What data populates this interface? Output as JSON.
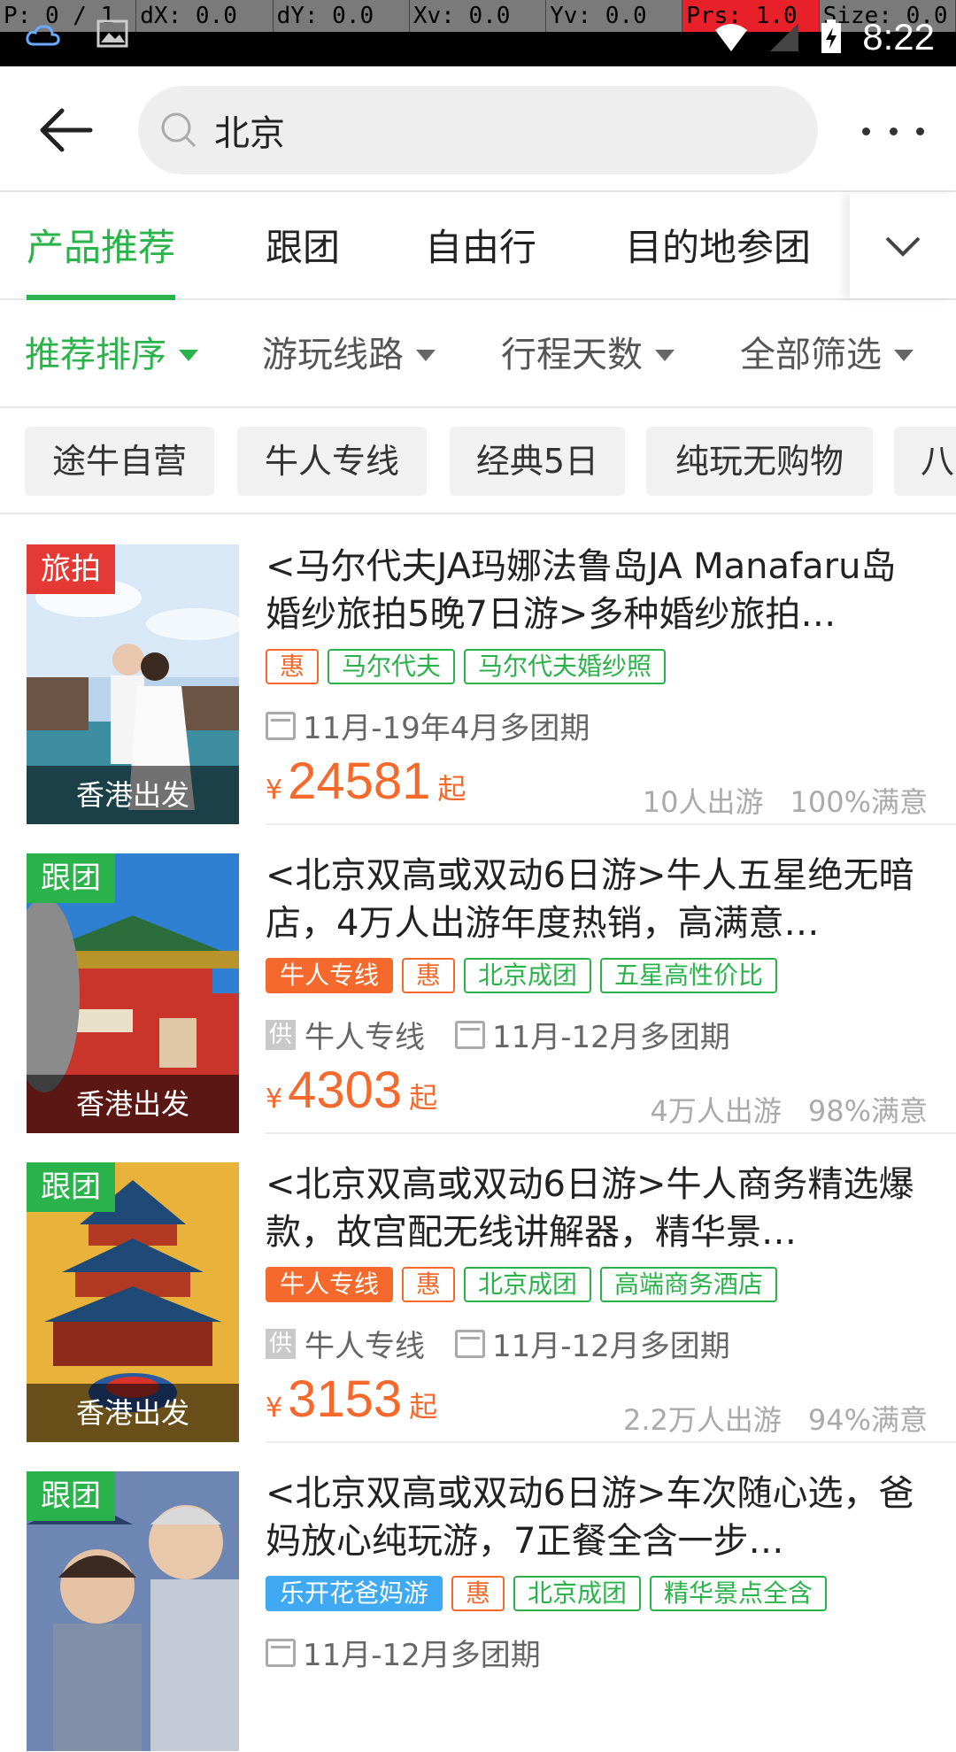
{
  "statusbar": {
    "debug": [
      "P: 0 / 1",
      "dX: 0.0",
      "dY: 0.0",
      "Xv: 0.0",
      "Yv: 0.0",
      "Prs: 1.0",
      "Size: 0.0"
    ],
    "time": "8:22"
  },
  "topbar": {
    "search_text": "北京"
  },
  "tabs": [
    "产品推荐",
    "跟团",
    "自由行",
    "目的地参团"
  ],
  "filters": [
    "推荐排序",
    "游玩线路",
    "行程天数",
    "全部筛选"
  ],
  "chips": [
    "途牛自营",
    "牛人专线",
    "经典5日",
    "纯玩无购物",
    "八"
  ],
  "products": [
    {
      "badge": "旅拍",
      "departure": "香港出发",
      "title": "<马尔代夫JA玛娜法鲁岛JA Manafaru岛婚纱旅拍5晚7日游>多种婚纱旅拍…",
      "tags": [
        "惠",
        "马尔代夫",
        "马尔代夫婚纱照"
      ],
      "supplier": "",
      "dates": "11月-19年4月多团期",
      "price_symbol": "¥",
      "price": "24581",
      "price_suffix": "起",
      "travelers": "10人出游",
      "satisfaction": "100%满意"
    },
    {
      "badge": "跟团",
      "departure": "香港出发",
      "title": "<北京双高或双动6日游>牛人五星绝无暗店，4万人出游年度热销，高满意…",
      "tags": [
        "牛人专线",
        "惠",
        "北京成团",
        "五星高性价比"
      ],
      "supplier_icon": "供",
      "supplier": "牛人专线",
      "dates": "11月-12月多团期",
      "price_symbol": "¥",
      "price": "4303",
      "price_suffix": "起",
      "travelers": "4万人出游",
      "satisfaction": "98%满意"
    },
    {
      "badge": "跟团",
      "departure": "香港出发",
      "title": "<北京双高或双动6日游>牛人商务精选爆款，故宫配无线讲解器，精华景…",
      "tags": [
        "牛人专线",
        "惠",
        "北京成团",
        "高端商务酒店"
      ],
      "supplier_icon": "供",
      "supplier": "牛人专线",
      "dates": "11月-12月多团期",
      "price_symbol": "¥",
      "price": "3153",
      "price_suffix": "起",
      "travelers": "2.2万人出游",
      "satisfaction": "94%满意"
    },
    {
      "badge": "跟团",
      "departure": "",
      "title": "<北京双高或双动6日游>车次随心选，爸妈放心纯玩游，7正餐全含一步…",
      "tags": [
        "乐开花爸妈游",
        "惠",
        "北京成团",
        "精华景点全含"
      ],
      "supplier": "",
      "dates": "11月-12月多团期"
    }
  ],
  "colors": {
    "accent_green": "#2bb34b",
    "price_orange": "#f56a2c",
    "tag_blue": "#40a9f4",
    "badge_red": "#e53935"
  }
}
